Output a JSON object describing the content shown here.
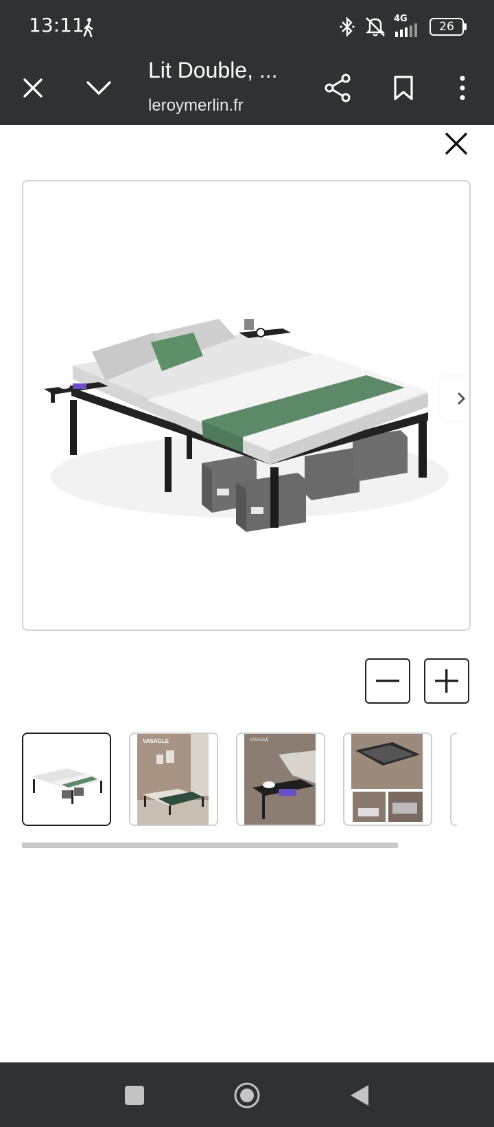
{
  "status_bar": {
    "time": "13:11",
    "network": "4G",
    "battery": "26"
  },
  "toolbar": {
    "title": "Lit Double, ...",
    "url": "leroymerlin.fr"
  },
  "gallery": {
    "thumbnails": [
      {
        "icon": "bed-photo",
        "selected": true
      },
      {
        "icon": "bedroom-photo",
        "caption": "VASAGLE"
      },
      {
        "icon": "side-table-photo",
        "caption": "VASAGLE"
      },
      {
        "icon": "storage-photo"
      }
    ],
    "scroll_position": 0.8
  },
  "colors": {
    "chrome": "#303134",
    "accent_green": "#5c8a68"
  }
}
